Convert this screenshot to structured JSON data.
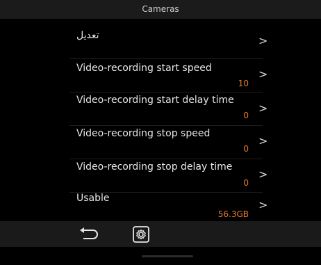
{
  "header": {
    "title": "Cameras"
  },
  "settings": {
    "items": [
      {
        "label": "تعديل",
        "value": "",
        "chevron": ">"
      },
      {
        "label": "Video-recording start speed",
        "value": "10",
        "chevron": ">"
      },
      {
        "label": "Video-recording start delay time",
        "value": "0",
        "chevron": ">"
      },
      {
        "label": "Video-recording stop speed",
        "value": "0",
        "chevron": ">"
      },
      {
        "label": "Video-recording stop delay time",
        "value": "0",
        "chevron": ">"
      },
      {
        "label": "Usable",
        "value": "56.3GB",
        "chevron": ">"
      }
    ]
  },
  "bottom_bar": {
    "back_icon": "back-arrow-icon",
    "settings_icon": "settings-gear-icon"
  },
  "colors": {
    "background": "#000000",
    "bar": "#1a1a1a",
    "text": "#e6e6e6",
    "accent": "#e87c2a"
  }
}
